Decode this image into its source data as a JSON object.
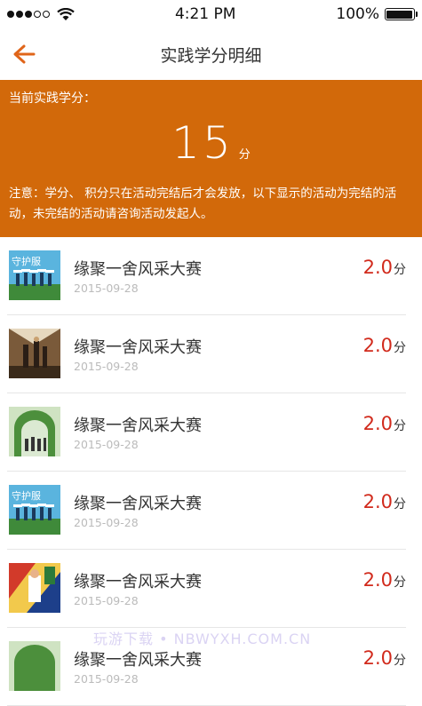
{
  "status_bar": {
    "time": "4:21 PM",
    "battery": "100%"
  },
  "navbar": {
    "title": "实践学分明细"
  },
  "summary": {
    "label": "当前实践学分：",
    "value": "15",
    "unit": "分",
    "note": "注意：学分、 积分只在活动完结后才会发放，以下显示的活动为完结的活动，未完结的活动请咨询活动发起人。"
  },
  "items": [
    {
      "title": "缘聚一舍风采大赛",
      "date": "2015-09-28",
      "score": "2.0",
      "unit": "分"
    },
    {
      "title": "缘聚一舍风采大赛",
      "date": "2015-09-28",
      "score": "2.0",
      "unit": "分"
    },
    {
      "title": "缘聚一舍风采大赛",
      "date": "2015-09-28",
      "score": "2.0",
      "unit": "分"
    },
    {
      "title": "缘聚一舍风采大赛",
      "date": "2015-09-28",
      "score": "2.0",
      "unit": "分"
    },
    {
      "title": "缘聚一舍风采大赛",
      "date": "2015-09-28",
      "score": "2.0",
      "unit": "分"
    },
    {
      "title": "缘聚一舍风采大赛",
      "date": "2015-09-28",
      "score": "2.0",
      "unit": "分"
    }
  ],
  "thumb_texts": {
    "guard": "守护服"
  },
  "watermark": "玩游下载 • NBWYXH.COM.CN",
  "colors": {
    "accent": "#d2690a",
    "score": "#d12a1c",
    "back_arrow": "#e0651a"
  }
}
